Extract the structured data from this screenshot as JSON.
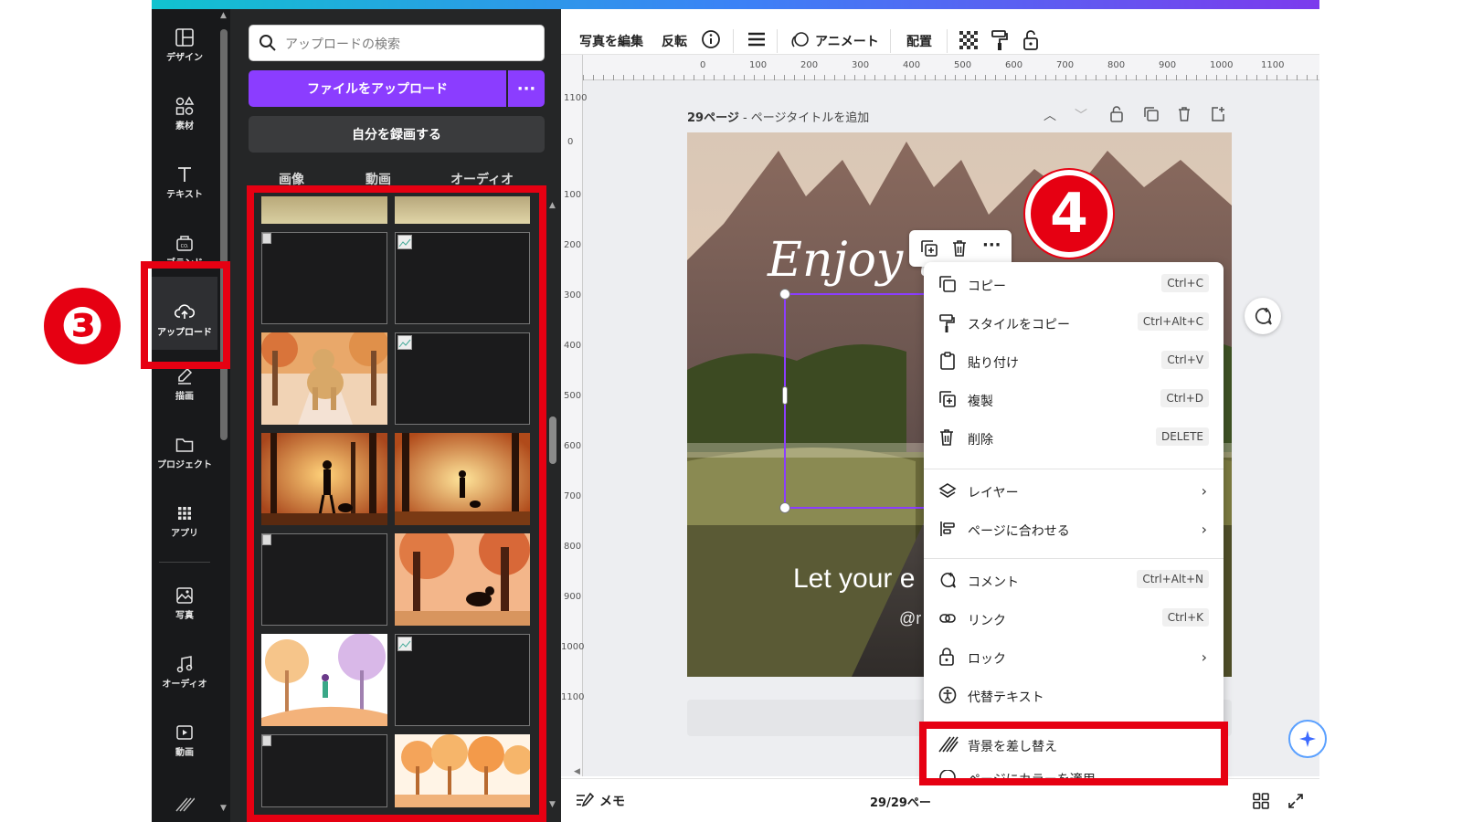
{
  "rail": {
    "items": [
      {
        "label": "デザイン",
        "icon": "layout-icon"
      },
      {
        "label": "素材",
        "icon": "elements-icon"
      },
      {
        "label": "テキスト",
        "icon": "text-icon"
      },
      {
        "label": "ブランド",
        "icon": "brand-icon"
      },
      {
        "label": "アップロード",
        "icon": "cloud-upload-icon"
      },
      {
        "label": "描画",
        "icon": "draw-icon"
      },
      {
        "label": "プロジェクト",
        "icon": "folder-icon"
      },
      {
        "label": "アプリ",
        "icon": "apps-grid-icon"
      },
      {
        "label": "写真",
        "icon": "photo-icon"
      },
      {
        "label": "オーディオ",
        "icon": "music-icon"
      },
      {
        "label": "動画",
        "icon": "video-icon"
      }
    ]
  },
  "panel": {
    "search_placeholder": "アップロードの検索",
    "upload_label": "ファイルをアップロード",
    "more_label": "···",
    "record_label": "自分を録画する",
    "tabs": [
      "画像",
      "動画",
      "オーディオ"
    ]
  },
  "toolbar": {
    "edit_photo": "写真を編集",
    "flip": "反転",
    "animate": "アニメート",
    "position": "配置"
  },
  "ruler": {
    "top": [
      "0",
      "100",
      "200",
      "300",
      "400",
      "500",
      "600",
      "700",
      "800",
      "900",
      "1000",
      "1100"
    ],
    "left": [
      "1100",
      "0",
      "100",
      "200",
      "300",
      "400",
      "500",
      "600",
      "700",
      "800",
      "900",
      "1000",
      "1100"
    ]
  },
  "page": {
    "number_label": "29ページ",
    "title_placeholder": "- ページタイトルを追加"
  },
  "canvas": {
    "script_text": "Enjoy t",
    "bottom_text": "Let your e",
    "handle_text": "@r"
  },
  "context_menu": {
    "items": [
      {
        "label": "コピー",
        "shortcut": "Ctrl+C"
      },
      {
        "label": "スタイルをコピー",
        "shortcut": "Ctrl+Alt+C"
      },
      {
        "label": "貼り付け",
        "shortcut": "Ctrl+V"
      },
      {
        "label": "複製",
        "shortcut": "Ctrl+D"
      },
      {
        "label": "削除",
        "shortcut": "DELETE"
      },
      {
        "label": "レイヤー"
      },
      {
        "label": "ページに合わせる"
      },
      {
        "label": "コメント",
        "shortcut": "Ctrl+Alt+N"
      },
      {
        "label": "リンク",
        "shortcut": "Ctrl+K"
      },
      {
        "label": "ロック"
      },
      {
        "label": "代替テキスト"
      },
      {
        "label": "背景を差し替え"
      },
      {
        "label": "ページにカラーを適用"
      }
    ]
  },
  "status": {
    "notes_label": "メモ",
    "page_count": "29/29ペー"
  },
  "annotations": {
    "step3": "❸",
    "step4": "4"
  },
  "colors": {
    "accent_purple": "#8b3dff",
    "highlight_red": "#e60012"
  }
}
